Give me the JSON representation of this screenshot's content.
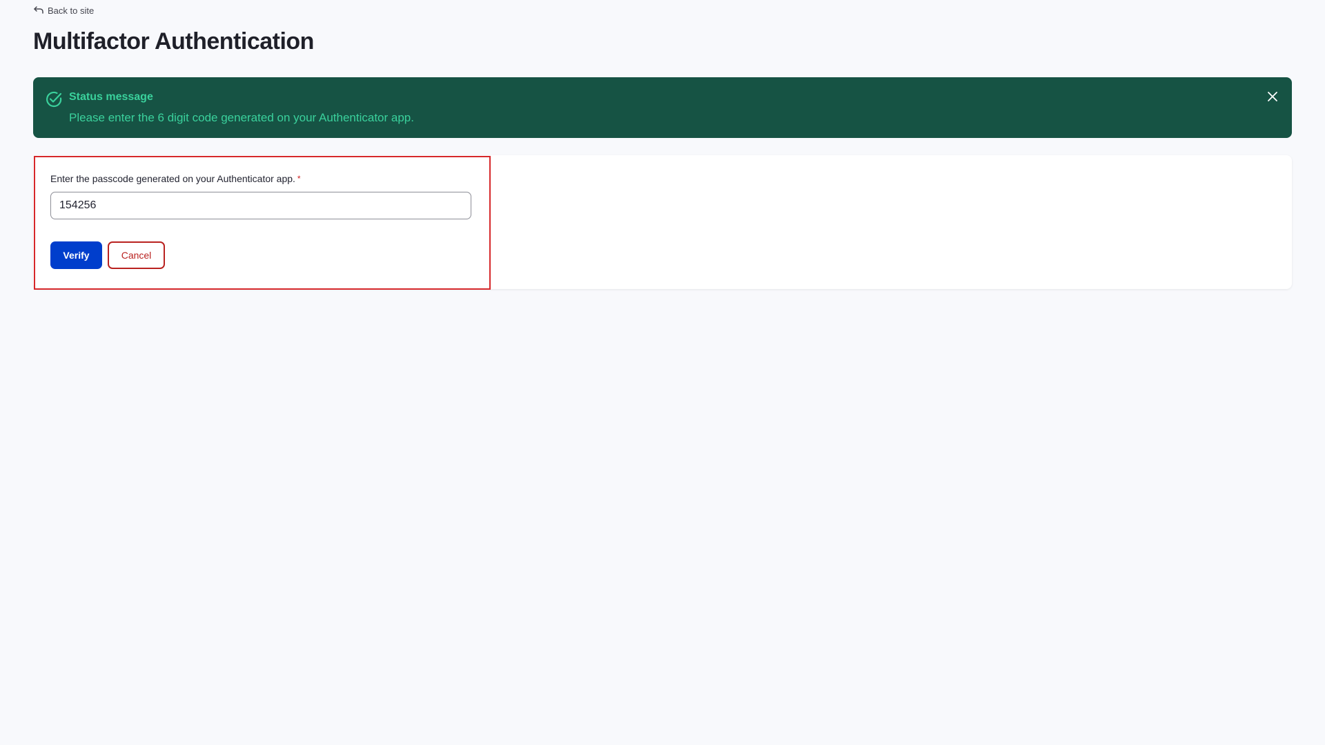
{
  "header": {
    "back_label": "Back to site",
    "title": "Multifactor Authentication"
  },
  "status": {
    "title": "Status message",
    "text": "Please enter the 6 digit code generated on your Authenticator app.",
    "bg_color": "#165344",
    "text_color": "#3ad19c",
    "icon": "check-circle-icon",
    "close_icon": "close-icon"
  },
  "form": {
    "label": "Enter the passcode generated on your Authenticator app.",
    "required_mark": "*",
    "passcode_value": "154256",
    "verify_label": "Verify",
    "cancel_label": "Cancel",
    "verify_color": "#003ecc",
    "cancel_color": "#b9211f",
    "highlight_color": "#d6272a"
  }
}
